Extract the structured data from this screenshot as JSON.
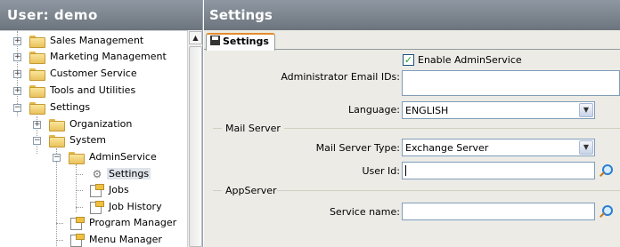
{
  "left_panel": {
    "title": "User: demo",
    "tree": [
      {
        "label": "Sales Management",
        "expander": "+"
      },
      {
        "label": "Marketing Management",
        "expander": "+"
      },
      {
        "label": "Customer Service",
        "expander": "+"
      },
      {
        "label": "Tools and Utilities",
        "expander": "+"
      },
      {
        "label": "Settings",
        "expander": "-"
      },
      {
        "label": "Organization",
        "expander": "+"
      },
      {
        "label": "System",
        "expander": "-"
      },
      {
        "label": "AdminService",
        "expander": "-"
      },
      {
        "label": "Settings",
        "selected": true
      },
      {
        "label": "Jobs"
      },
      {
        "label": "Job History"
      },
      {
        "label": "Program Manager"
      },
      {
        "label": "Menu Manager"
      }
    ]
  },
  "right_panel": {
    "title": "Settings",
    "tab_label": "Settings",
    "form": {
      "enable_admin_service": {
        "label": "Enable AdminService",
        "checked": true
      },
      "admin_email": {
        "label": "Administrator Email IDs:",
        "value": ""
      },
      "language": {
        "label": "Language:",
        "value": "ENGLISH"
      },
      "mail_server_section": "Mail Server",
      "mail_server_type": {
        "label": "Mail Server Type:",
        "value": "Exchange Server"
      },
      "user_id": {
        "label": "User Id:",
        "value": ""
      },
      "app_server_section": "AppServer",
      "service_name": {
        "label": "Service name:",
        "value": ""
      }
    }
  },
  "icons": {
    "folder": "folder-icon",
    "document": "document-icon",
    "settings": "gear-icon",
    "save": "save-icon",
    "lookup": "magnifier-icon",
    "dropdown": "chevron-down-icon",
    "scroll_up": "arrow-up-icon"
  },
  "colors": {
    "header_bg": "#7e868f",
    "tab_accent": "#e68b2c",
    "panel_bg": "#ecebe6"
  }
}
